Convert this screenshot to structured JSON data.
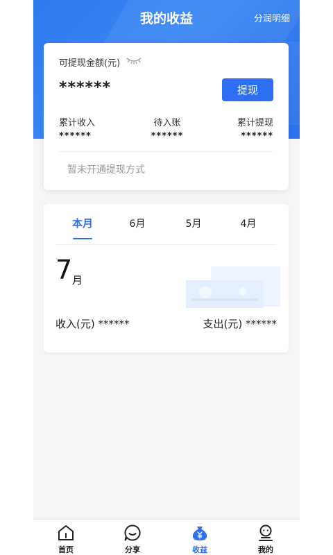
{
  "header": {
    "title": "我的收益",
    "detail_link": "分润明细"
  },
  "balance": {
    "label": "可提现金额(元)",
    "value": "******",
    "withdraw_button": "提现",
    "stats": [
      {
        "label": "累计收入",
        "value": "******"
      },
      {
        "label": "待入账",
        "value": "******"
      },
      {
        "label": "累计提现",
        "value": "******"
      }
    ],
    "method_text": "暂未开通提现方式"
  },
  "monthly": {
    "tabs": [
      {
        "label": "本月",
        "active": true
      },
      {
        "label": "6月",
        "active": false
      },
      {
        "label": "5月",
        "active": false
      },
      {
        "label": "4月",
        "active": false
      }
    ],
    "month_number": "7",
    "month_suffix": "月",
    "income": "收入(元) ******",
    "expense": "支出(元) ******"
  },
  "nav": {
    "items": [
      {
        "label": "首页",
        "icon": "home-icon",
        "active": false
      },
      {
        "label": "分享",
        "icon": "share-chat-icon",
        "active": false
      },
      {
        "label": "收益",
        "icon": "earnings-bag-icon",
        "active": true
      },
      {
        "label": "我的",
        "icon": "profile-icon",
        "active": false
      }
    ]
  },
  "colors": {
    "primary": "#2d6ff0",
    "header": "#3a86f5",
    "background": "#f5f5f6"
  }
}
